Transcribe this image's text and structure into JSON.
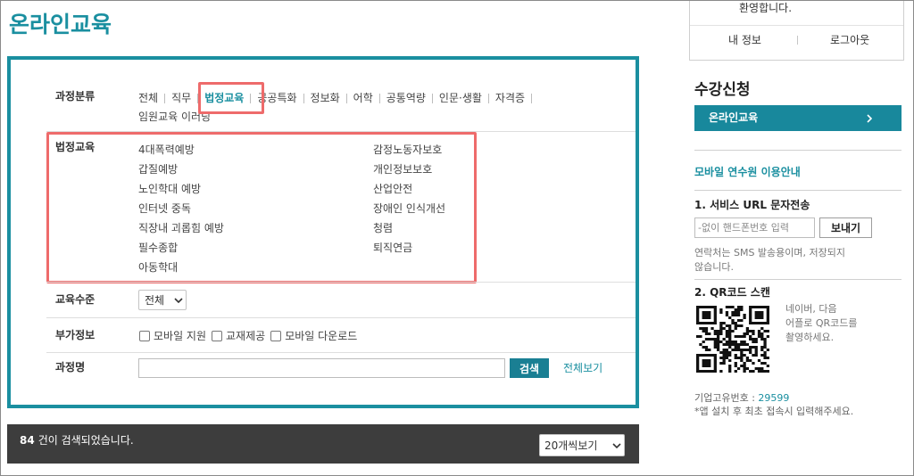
{
  "page": {
    "title": "온라인교육"
  },
  "colors": {
    "accent": "#1a8fa0",
    "annotation_red": "#ee6b6b",
    "result_bar": "#3d3d3d"
  },
  "filters": {
    "category": {
      "label": "과정분류",
      "items": [
        {
          "label": "전체"
        },
        {
          "label": "직무"
        },
        {
          "label": "법정교육",
          "selected": true
        },
        {
          "label": "공공특화"
        },
        {
          "label": "정보화"
        },
        {
          "label": "어학"
        },
        {
          "label": "공통역량"
        },
        {
          "label": "인문·생활"
        },
        {
          "label": "자격증"
        },
        {
          "label": "임원교육 이러닝"
        }
      ]
    },
    "subcategory": {
      "label": "법정교육",
      "items": [
        "4대폭력예방",
        "감정노동자보호",
        "갑질예방",
        "개인정보보호",
        "노인학대 예방",
        "산업안전",
        "인터넷 중독",
        "장애인 인식개선",
        "직장내 괴롭힘 예방",
        "청렴",
        "필수종합",
        "퇴직연금",
        "아동학대"
      ]
    },
    "level": {
      "label": "교육수준",
      "selected": "전체"
    },
    "extra": {
      "label": "부가정보",
      "options": [
        {
          "label": "모바일 지원",
          "checked": false
        },
        {
          "label": "교재제공",
          "checked": false
        },
        {
          "label": "모바일 다운로드",
          "checked": false
        }
      ]
    },
    "course_name": {
      "label": "과정명",
      "value": "",
      "search_button": "검색",
      "view_all": "전체보기"
    }
  },
  "results": {
    "count": "84",
    "suffix": "건이 검색되었습니다.",
    "page_size": "20개씩보기"
  },
  "sidebar": {
    "user": {
      "welcome": "환영합니다.",
      "my_info": "내 정보",
      "logout": "로그아웃"
    },
    "enroll": {
      "heading": "수강신청",
      "online_label": "온라인교육",
      "arrow_icon": "chevron-right-icon"
    },
    "mobile": {
      "title": "모바일 연수원 이용안내",
      "sms_title": "1. 서비스 URL 문자전송",
      "phone_placeholder": "-없이 핸드폰번호 입력",
      "send_label": "보내기",
      "sms_note_lines": [
        "연락처는 SMS 발송용이며, 저장되지",
        "않습니다."
      ],
      "qr_title": "2. QR코드 스캔",
      "qr_note_lines": [
        "네이버, 다음",
        "어플로 QR코드를",
        "촬영하세요."
      ],
      "company_code_label": "기업고유번호 : ",
      "company_code": "29599",
      "company_code_note": "*앱 설치 후 최초 접속시 입력해주세요."
    }
  }
}
